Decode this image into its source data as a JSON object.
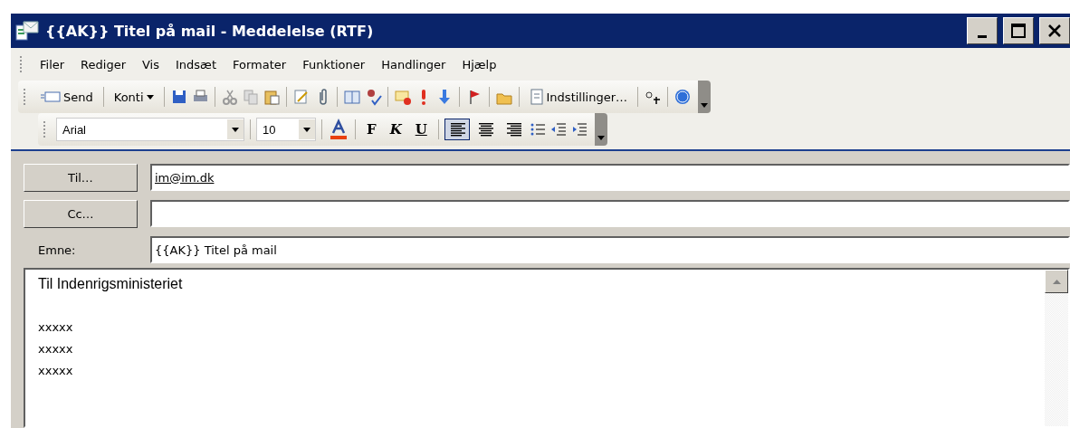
{
  "window": {
    "title": "{{AK}} Titel på mail - Meddelelse (RTF)"
  },
  "menu": [
    "Filer",
    "Rediger",
    "Vis",
    "Indsæt",
    "Formater",
    "Funktioner",
    "Handlinger",
    "Hjælp"
  ],
  "standard_toolbar": {
    "send": "Send",
    "accounts": "Konti",
    "options": "Indstillinger…"
  },
  "format_toolbar": {
    "font": "Arial",
    "size": "10",
    "bold": "F",
    "italic": "K",
    "underline": "U",
    "alignment": [
      {
        "selected": true
      },
      {
        "selected": false
      },
      {
        "selected": false
      }
    ]
  },
  "header": {
    "to_button": "Til…",
    "to_value": "im@im.dk",
    "cc_button": "Cc…",
    "subject_label": "Emne:",
    "subject_value": "{{AK}} Titel på mail"
  },
  "body": {
    "greeting": "Til Indenrigsministeriet",
    "lines": [
      "xxxxx",
      "xxxxx",
      "xxxxx"
    ]
  }
}
